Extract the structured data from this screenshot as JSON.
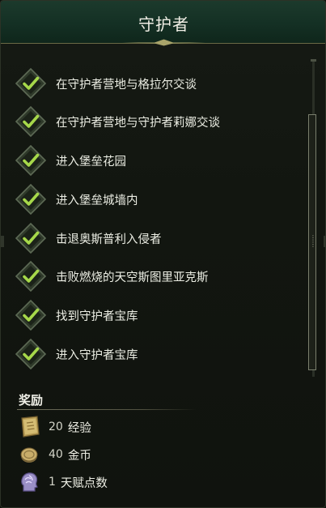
{
  "header": {
    "title": "守护者"
  },
  "objectives": [
    {
      "text": "在守护者营地与格拉尔交谈",
      "completed": true
    },
    {
      "text": "在守护者营地与守护者莉娜交谈",
      "completed": true
    },
    {
      "text": "进入堡垒花园",
      "completed": true
    },
    {
      "text": "进入堡垒城墙内",
      "completed": true
    },
    {
      "text": "击退奥斯普利入侵者",
      "completed": true
    },
    {
      "text": "击败燃烧的天空斯图里亚克斯",
      "completed": true
    },
    {
      "text": "找到守护者宝库",
      "completed": true
    },
    {
      "text": "进入守护者宝库",
      "completed": true
    }
  ],
  "rewards": {
    "title": "奖励",
    "items": [
      {
        "amount": "20",
        "label": "经验",
        "icon": "xp-book-icon"
      },
      {
        "amount": "40",
        "label": "金币",
        "icon": "gold-coin-icon"
      },
      {
        "amount": "1",
        "label": "天赋点数",
        "icon": "talent-head-icon"
      }
    ]
  },
  "colors": {
    "header_bg": "#163226",
    "check_green": "#a6d84a",
    "text": "#eceee4",
    "gold_line": "#6b6a45"
  }
}
